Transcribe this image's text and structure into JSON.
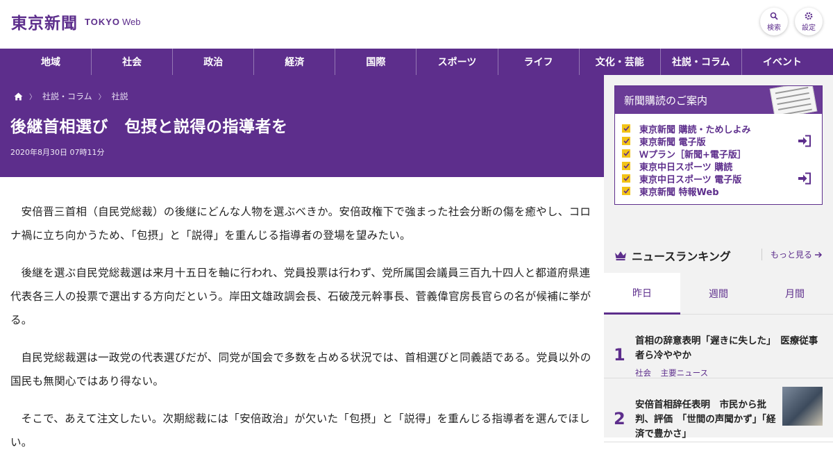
{
  "header": {
    "logo_text": "東京新聞",
    "logo_sub_bold": "TOKYO",
    "logo_sub_light": "Web",
    "search_label": "検索",
    "settings_label": "設定"
  },
  "nav": {
    "items": [
      "地域",
      "社会",
      "政治",
      "経済",
      "国際",
      "スポーツ",
      "ライフ",
      "文化・芸能",
      "社説・コラム",
      "イベント"
    ]
  },
  "breadcrumb": {
    "items": [
      "社説・コラム",
      "社説"
    ]
  },
  "article": {
    "title": "後継首相選び　包摂と説得の指導者を",
    "date": "2020年8月30日 07時11分",
    "paragraphs": [
      "安倍晋三首相（自民党総裁）の後継にどんな人物を選ぶべきか。安倍政権下で強まった社会分断の傷を癒やし、コロナ禍に立ち向かうため、「包摂」と「説得」を重んじる指導者の登場を望みたい。",
      "後継を選ぶ自民党総裁選は来月十五日を軸に行われ、党員投票は行わず、党所属国会議員三百九十四人と都道府県連代表各三人の投票で選出する方向だという。岸田文雄政調会長、石破茂元幹事長、菅義偉官房長官らの名が候補に挙がる。",
      "自民党総裁選は一政党の代表選びだが、同党が国会で多数を占める状況では、首相選びと同義語である。党員以外の国民も無関心ではあり得ない。",
      "そこで、あえて注文したい。次期総裁には「安倍政治」が欠いた「包摂」と「説得」を重んじる指導者を選んでほしい。"
    ]
  },
  "subscription": {
    "title": "新聞購読のご案内",
    "items": [
      {
        "label": "東京新聞 購読・ためしよみ",
        "login": false
      },
      {
        "label": "東京新聞 電子版",
        "login": true
      },
      {
        "label": "Ｗプラン［新聞+電子版］",
        "login": false
      },
      {
        "label": "東京中日スポーツ 購読",
        "login": false
      },
      {
        "label": "東京中日スポーツ 電子版",
        "login": true
      },
      {
        "label": "東京新聞 特報Web",
        "login": false
      }
    ]
  },
  "ranking": {
    "title": "ニュースランキング",
    "more_label": "もっと見る",
    "tabs": [
      {
        "label": "昨日",
        "active": true
      },
      {
        "label": "週間",
        "active": false
      },
      {
        "label": "月間",
        "active": false
      }
    ],
    "items": [
      {
        "rank": "1",
        "title": "首相の辞意表明「遅きに失した」　医療従事者ら冷ややか",
        "tags": [
          "社会",
          "主要ニュース"
        ],
        "thumbnail": false
      },
      {
        "rank": "2",
        "title": "安倍首相辞任表明　市民から批判、評価　「世間の声聞かず」「経済で豊かさ」",
        "tags": [],
        "thumbnail": true
      }
    ]
  },
  "colors": {
    "brand": "#5d2e8c",
    "check": "#f2c316"
  }
}
